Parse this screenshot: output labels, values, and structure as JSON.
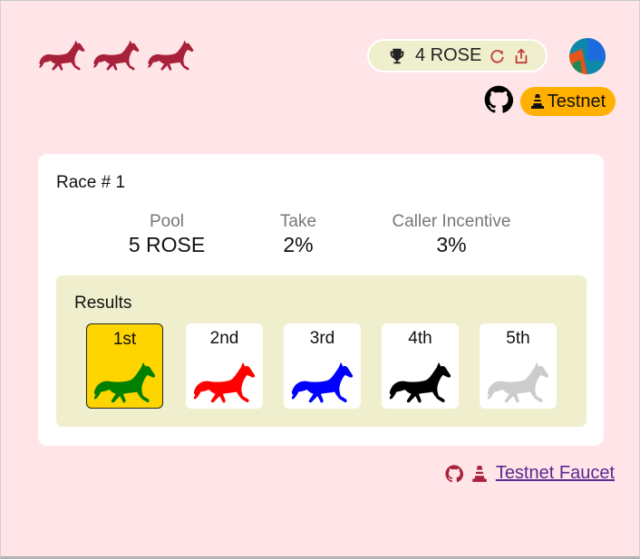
{
  "header": {
    "logo_horses": [
      "horse-icon",
      "horse-icon",
      "horse-icon"
    ],
    "balance": "4 ROSE",
    "network": "Testnet"
  },
  "race": {
    "title": "Race # 1",
    "stats": [
      {
        "label": "Pool",
        "value": "5 ROSE"
      },
      {
        "label": "Take",
        "value": "2%"
      },
      {
        "label": "Caller Incentive",
        "value": "3%"
      }
    ],
    "results": {
      "title": "Results",
      "places": [
        {
          "label": "1st",
          "horse_color": "#008000"
        },
        {
          "label": "2nd",
          "horse_color": "#ff0000"
        },
        {
          "label": "3rd",
          "horse_color": "#0000ff"
        },
        {
          "label": "4th",
          "horse_color": "#000000"
        },
        {
          "label": "5th",
          "horse_color": "#cccccc"
        }
      ]
    }
  },
  "footer": {
    "faucet_link": "Testnet Faucet"
  },
  "colors": {
    "background": "#ffe4e8",
    "accent": "#a8213a",
    "winner": "#ffd500",
    "network_badge": "#ffb000",
    "results_panel": "#f0efcd"
  }
}
